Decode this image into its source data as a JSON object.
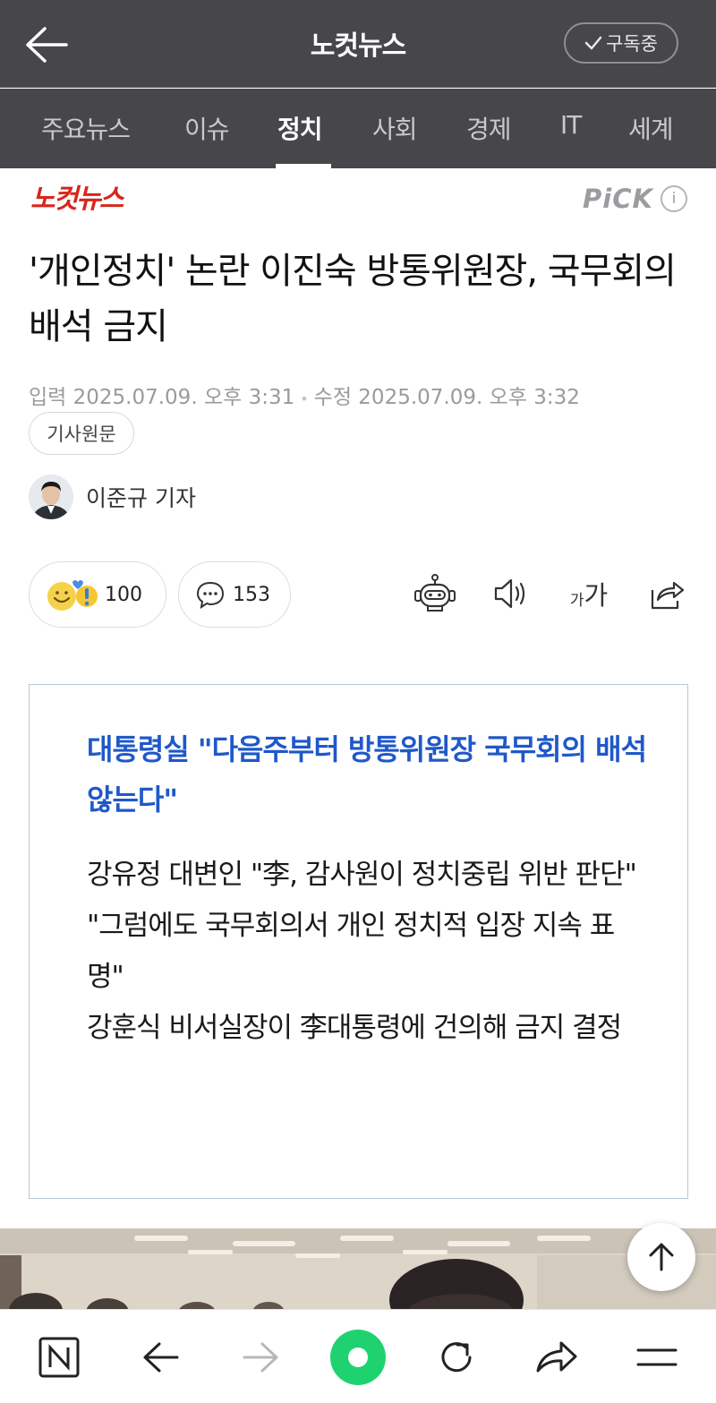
{
  "header": {
    "title": "노컷뉴스",
    "subscribe_label": "구독중"
  },
  "tabs": [
    {
      "label": "주요뉴스",
      "active": false
    },
    {
      "label": "이슈",
      "active": false
    },
    {
      "label": "정치",
      "active": true
    },
    {
      "label": "사회",
      "active": false
    },
    {
      "label": "경제",
      "active": false
    },
    {
      "label": "IT",
      "active": false
    },
    {
      "label": "세계",
      "active": false
    }
  ],
  "article": {
    "press_logo_text": "노컷뉴스",
    "pick_label": "PiCK",
    "headline": "'개인정치' 논란 이진숙 방통위원장, 국무회의 배석 금지",
    "input_time": "입력 2025.07.09. 오후 3:31",
    "modified_time": "수정 2025.07.09. 오후 3:32",
    "original_button": "기사원문",
    "reporter": "이준규 기자",
    "reaction_count": "100",
    "comment_count": "153",
    "font_size_label_small": "가",
    "font_size_label_large": "가"
  },
  "summary": {
    "title": "대통령실 \"다음주부터 방통위원장 국무회의 배석 않는다\"",
    "lines": [
      "강유정 대변인 \"李, 감사원이 정치중립 위반 판단\"",
      "\"그럼에도 국무회의서 개인 정치적 입장 지속 표명\"",
      "강훈식 비서실장이 李대통령에 건의해 금지 결정"
    ]
  },
  "colors": {
    "header_bg": "#46464b",
    "summary_title": "#1f58c9",
    "summary_border": "#b8c7d6",
    "press_red": "#d8261c",
    "home_green": "#1ed36f"
  }
}
